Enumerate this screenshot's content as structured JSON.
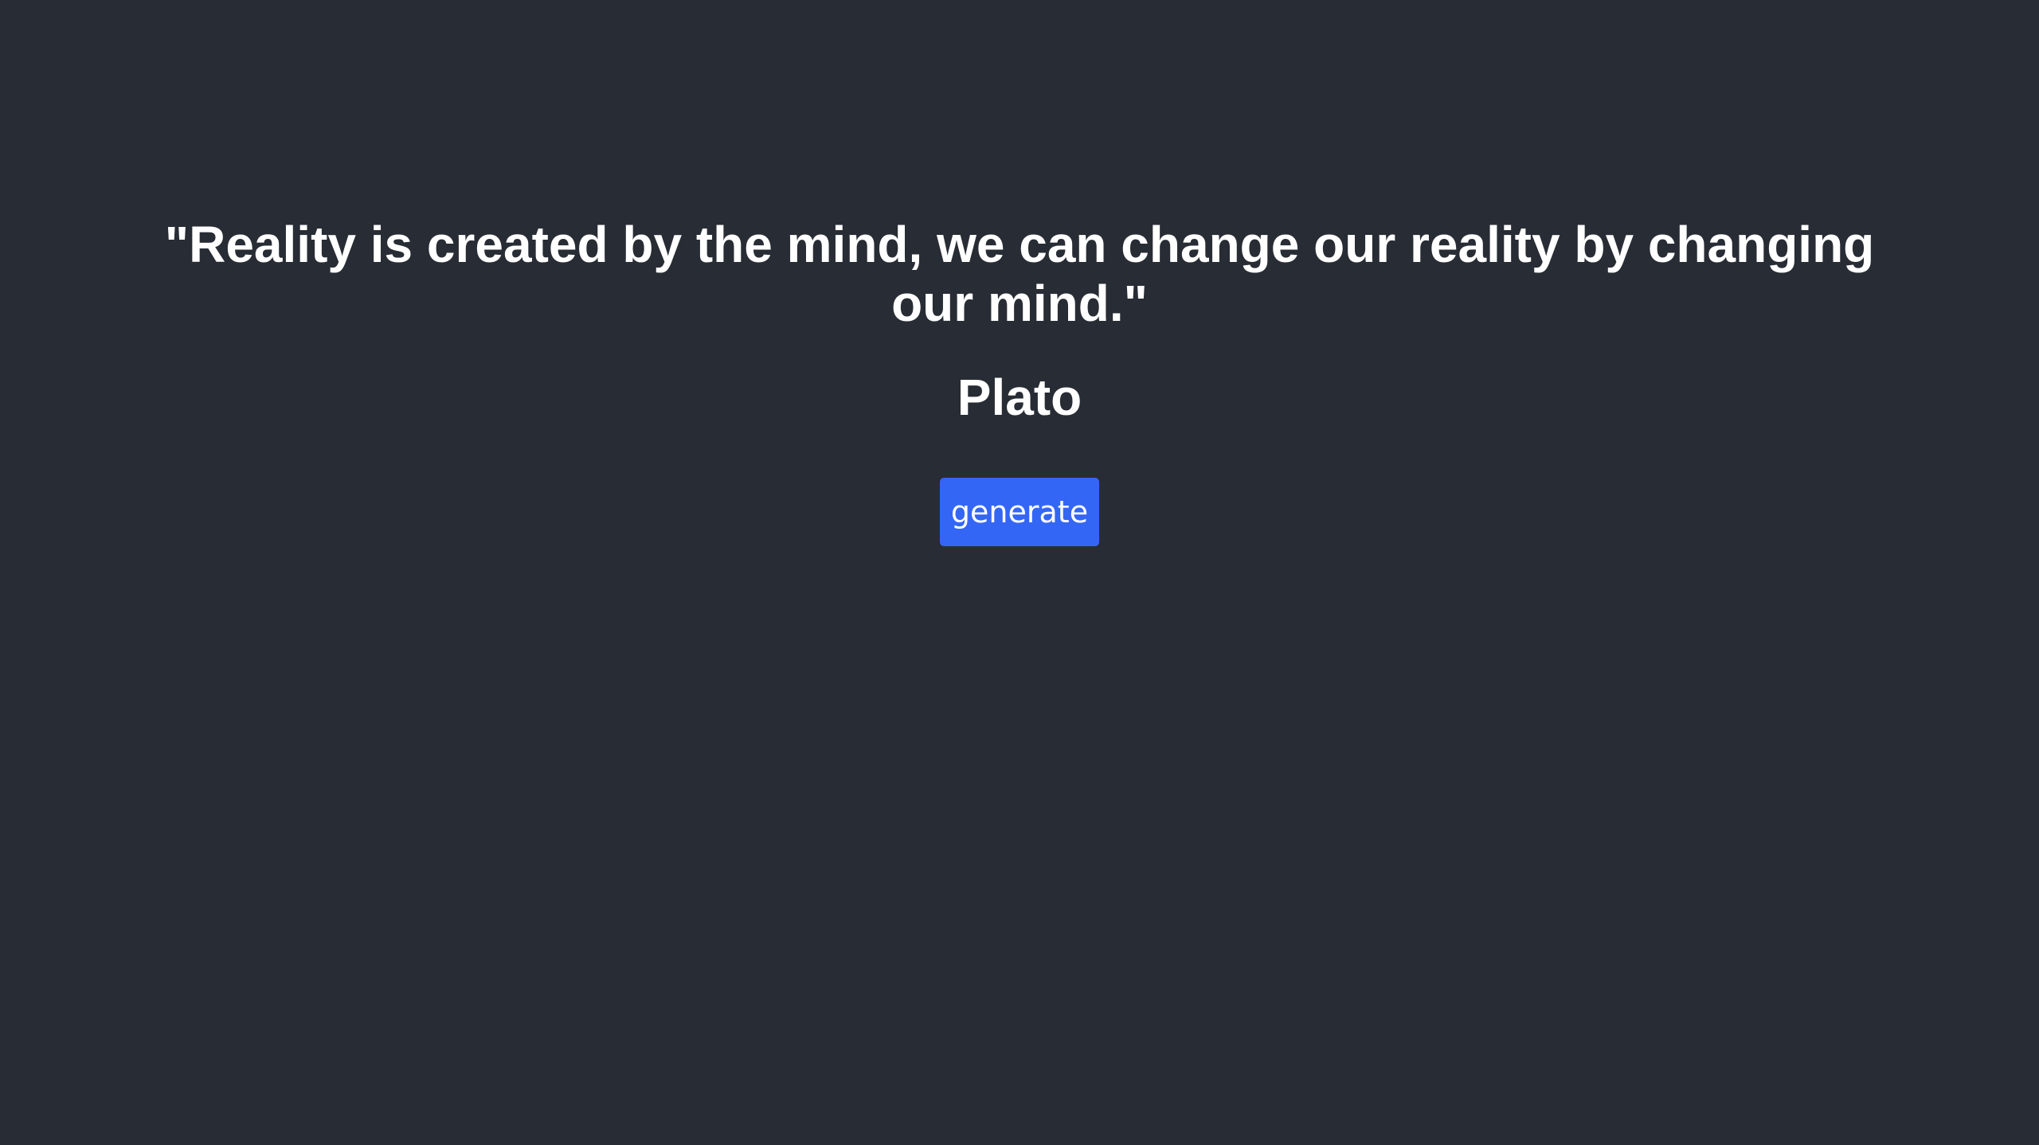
{
  "quote": {
    "text": "\"Reality is created by the mind, we can change our reality by changing our mind.\"",
    "author": "Plato"
  },
  "actions": {
    "generate_label": "generate"
  },
  "colors": {
    "background": "#282c34",
    "text": "#ffffff",
    "button": "#3466f6"
  }
}
